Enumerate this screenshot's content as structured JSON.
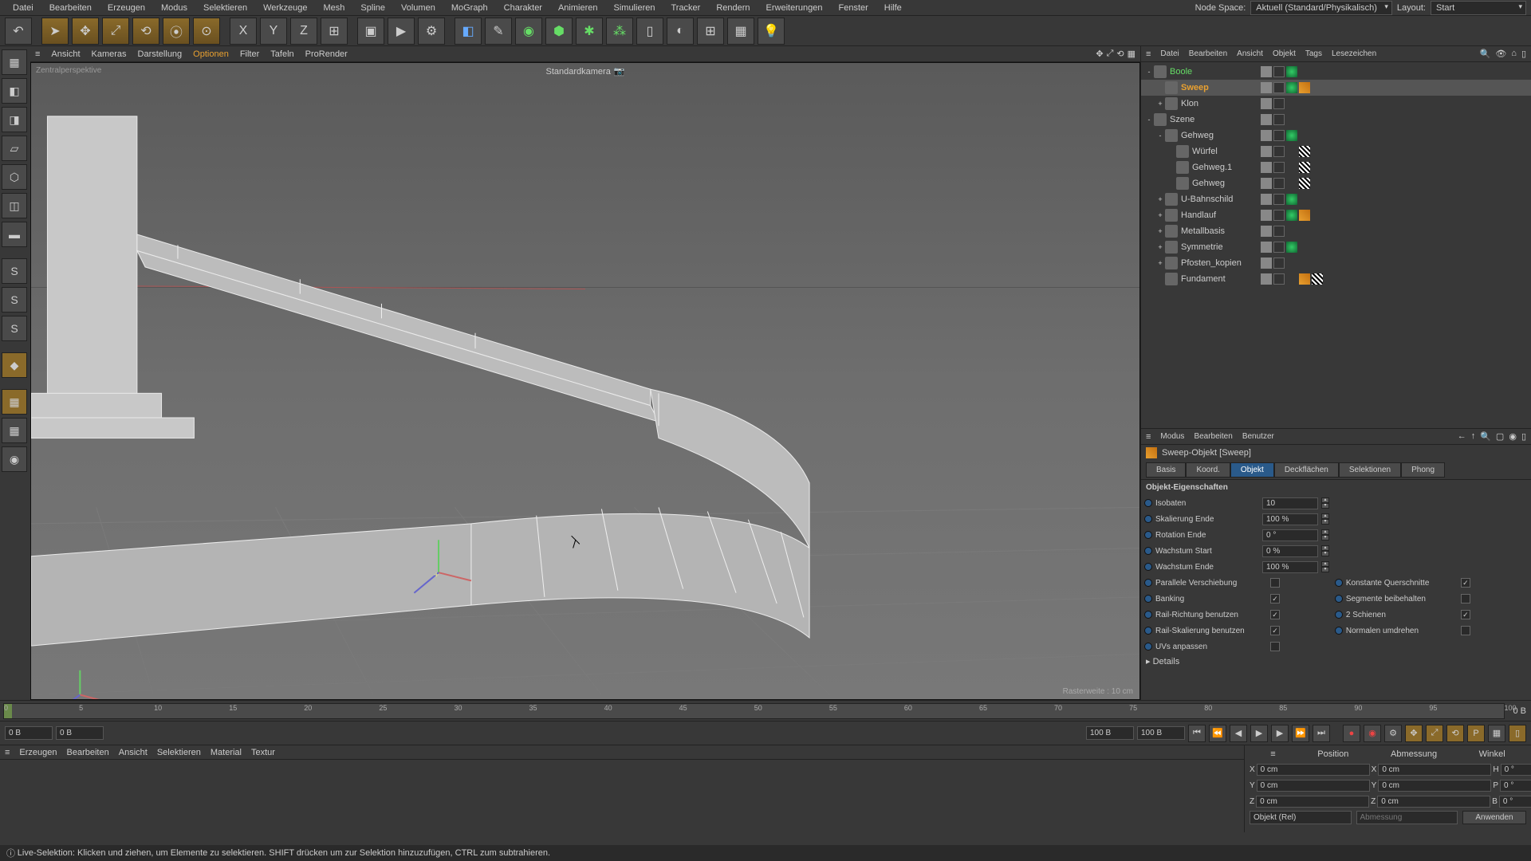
{
  "menubar": [
    "Datei",
    "Bearbeiten",
    "Erzeugen",
    "Modus",
    "Selektieren",
    "Werkzeuge",
    "Mesh",
    "Spline",
    "Volumen",
    "MoGraph",
    "Charakter",
    "Animieren",
    "Simulieren",
    "Tracker",
    "Rendern",
    "Erweiterungen",
    "Fenster",
    "Hilfe"
  ],
  "header_right": {
    "node_space_lbl": "Node Space:",
    "node_space_val": "Aktuell (Standard/Physikalisch)",
    "layout_lbl": "Layout:",
    "layout_val": "Start"
  },
  "viewport": {
    "menus": [
      "Ansicht",
      "Kameras",
      "Darstellung",
      "Optionen",
      "Filter",
      "Tafeln",
      "ProRender"
    ],
    "active_menu_index": 3,
    "label": "Zentralperspektive",
    "camera": "Standardkamera",
    "footer": "Rasterweite : 10 cm"
  },
  "obj_panel_menus": [
    "Datei",
    "Bearbeiten",
    "Ansicht",
    "Objekt",
    "Tags",
    "Lesezeichen"
  ],
  "tree": [
    {
      "depth": 0,
      "name": "Boole",
      "cls": "green",
      "exp": "-",
      "tags": [
        "layer",
        "dots",
        "chk"
      ]
    },
    {
      "depth": 1,
      "name": "Sweep",
      "cls": "orange",
      "exp": "",
      "sel": true,
      "tags": [
        "layer",
        "dots",
        "chk",
        "sweep"
      ]
    },
    {
      "depth": 1,
      "name": "Klon",
      "cls": "",
      "exp": "+",
      "tags": [
        "layer",
        "dots"
      ]
    },
    {
      "depth": 0,
      "name": "Szene",
      "cls": "",
      "exp": "-",
      "tags": [
        "layer",
        "dots"
      ]
    },
    {
      "depth": 1,
      "name": "Gehweg",
      "cls": "",
      "exp": "-",
      "tags": [
        "layer",
        "dots",
        "chk"
      ]
    },
    {
      "depth": 2,
      "name": "Würfel",
      "cls": "",
      "exp": "",
      "tags": [
        "layer",
        "dots",
        "",
        "checker"
      ]
    },
    {
      "depth": 2,
      "name": "Gehweg.1",
      "cls": "",
      "exp": "",
      "tags": [
        "layer",
        "dots",
        "",
        "checker"
      ]
    },
    {
      "depth": 2,
      "name": "Gehweg",
      "cls": "",
      "exp": "",
      "tags": [
        "layer",
        "dots",
        "",
        "checker"
      ]
    },
    {
      "depth": 1,
      "name": "U-Bahnschild",
      "cls": "",
      "exp": "+",
      "tags": [
        "layer",
        "dots",
        "chk"
      ]
    },
    {
      "depth": 1,
      "name": "Handlauf",
      "cls": "",
      "exp": "+",
      "tags": [
        "layer",
        "dots",
        "chk",
        "sweep"
      ]
    },
    {
      "depth": 1,
      "name": "Metallbasis",
      "cls": "",
      "exp": "+",
      "tags": [
        "layer",
        "dots"
      ]
    },
    {
      "depth": 1,
      "name": "Symmetrie",
      "cls": "",
      "exp": "+",
      "tags": [
        "layer",
        "dots",
        "chk"
      ]
    },
    {
      "depth": 1,
      "name": "Pfosten_kopien",
      "cls": "",
      "exp": "+",
      "tags": [
        "layer",
        "dots"
      ]
    },
    {
      "depth": 1,
      "name": "Fundament",
      "cls": "",
      "exp": "",
      "tags": [
        "layer",
        "dots",
        "",
        "sweep",
        "checker"
      ]
    }
  ],
  "attr": {
    "menus": [
      "Modus",
      "Bearbeiten",
      "Benutzer"
    ],
    "title": "Sweep-Objekt [Sweep]",
    "tabs": [
      "Basis",
      "Koord.",
      "Objekt",
      "Deckflächen",
      "Selektionen",
      "Phong"
    ],
    "active_tab": 2,
    "section": "Objekt-Eigenschaften",
    "rows": [
      {
        "lbl": "Isobaten",
        "val": "10"
      },
      {
        "lbl": "Skalierung Ende",
        "val": "100 %"
      },
      {
        "lbl": "Rotation Ende",
        "val": "0 °"
      },
      {
        "lbl": "Wachstum Start",
        "val": "0 %"
      },
      {
        "lbl": "Wachstum Ende",
        "val": "100 %"
      }
    ],
    "checks": [
      {
        "l": "Parallele Verschiebung",
        "lc": false,
        "r": "Konstante Querschnitte",
        "rc": true
      },
      {
        "l": "Banking",
        "lc": true,
        "r": "Segmente beibehalten",
        "rc": false
      },
      {
        "l": "Rail-Richtung benutzen",
        "lc": true,
        "r": "2 Schienen",
        "rc": true
      },
      {
        "l": "Rail-Skalierung benutzen",
        "lc": true,
        "r": "Normalen umdrehen",
        "rc": false
      },
      {
        "l": "UVs anpassen",
        "lc": false,
        "r": "",
        "rc": false
      }
    ],
    "details": "Details"
  },
  "timeline": {
    "start": "0 B",
    "startB": "0 B",
    "end": "100 B",
    "endB": "100 B",
    "current": "0 B",
    "ticks": [
      0,
      5,
      10,
      15,
      20,
      25,
      30,
      35,
      40,
      45,
      50,
      55,
      60,
      65,
      70,
      75,
      80,
      85,
      90,
      95,
      100
    ]
  },
  "mat_menus": [
    "Erzeugen",
    "Bearbeiten",
    "Ansicht",
    "Selektieren",
    "Material",
    "Textur"
  ],
  "coord": {
    "headers": [
      "Position",
      "Abmessung",
      "Winkel"
    ],
    "rows": [
      {
        "a": "X",
        "p": "0 cm",
        "ab": "X",
        "d": "0 cm",
        "w": "H",
        "wv": "0 °"
      },
      {
        "a": "Y",
        "p": "0 cm",
        "ab": "Y",
        "d": "0 cm",
        "w": "P",
        "wv": "0 °"
      },
      {
        "a": "Z",
        "p": "0 cm",
        "ab": "Z",
        "d": "0 cm",
        "w": "B",
        "wv": "0 °"
      }
    ],
    "mode1": "Objekt (Rel)",
    "mode2": "Abmessung",
    "apply": "Anwenden"
  },
  "status": "Live-Selektion: Klicken und ziehen, um Elemente zu selektieren. SHIFT drücken um zur Selektion hinzuzufügen, CTRL zum subtrahieren."
}
